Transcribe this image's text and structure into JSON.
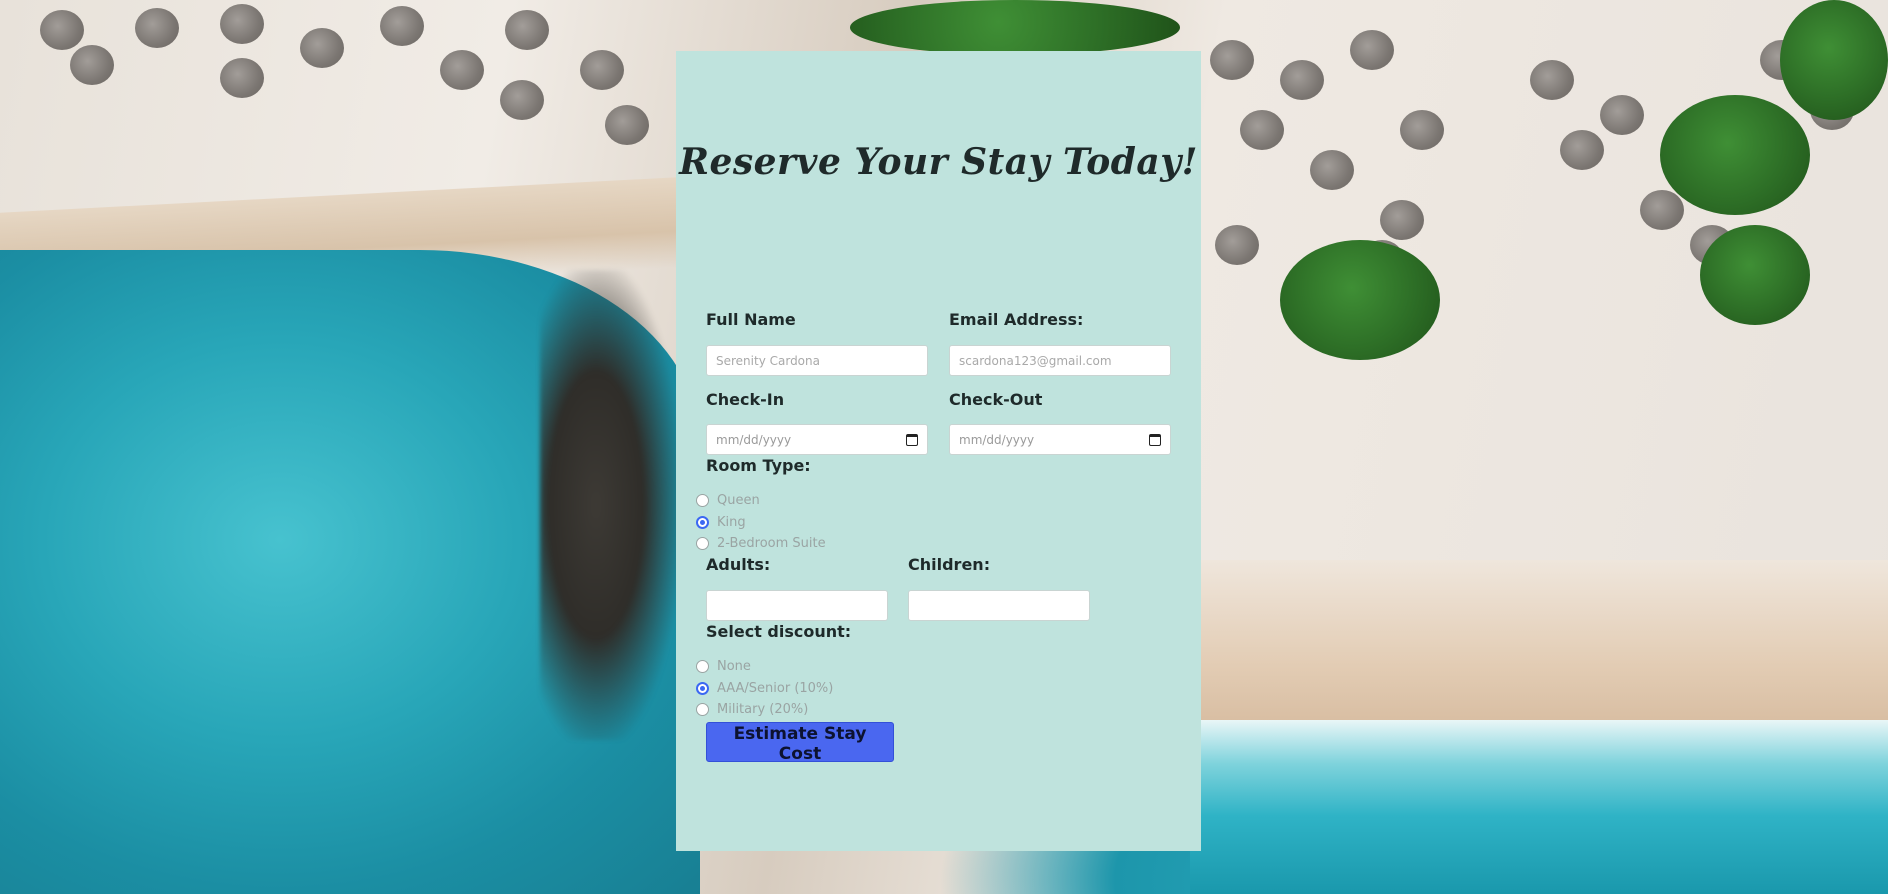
{
  "form": {
    "title": "Reserve Your Stay Today!",
    "full_name": {
      "label": "Full Name",
      "placeholder": "Serenity Cardona"
    },
    "email": {
      "label": "Email Address:",
      "placeholder": "scardona123@gmail.com"
    },
    "check_in": {
      "label": "Check-In",
      "placeholder": "mm/dd/yyyy"
    },
    "check_out": {
      "label": "Check-Out",
      "placeholder": "mm/dd/yyyy"
    },
    "room_type": {
      "label": "Room Type:",
      "options": [
        "Queen",
        "King",
        "2-Bedroom Suite"
      ],
      "selected": "King"
    },
    "adults": {
      "label": "Adults:",
      "value": ""
    },
    "children": {
      "label": "Children:",
      "value": ""
    },
    "discount": {
      "label": "Select discount:",
      "options": [
        "None",
        "AAA/Senior (10%)",
        "Military (20%)"
      ],
      "selected": "AAA/Senior (10%)"
    },
    "submit_label": "Estimate Stay Cost"
  },
  "colors": {
    "card_background": "#bfe3dd",
    "button": "#4a67f0",
    "radio_checked": "#3c68f3"
  },
  "icons": {
    "date_picker": "calendar-icon"
  }
}
